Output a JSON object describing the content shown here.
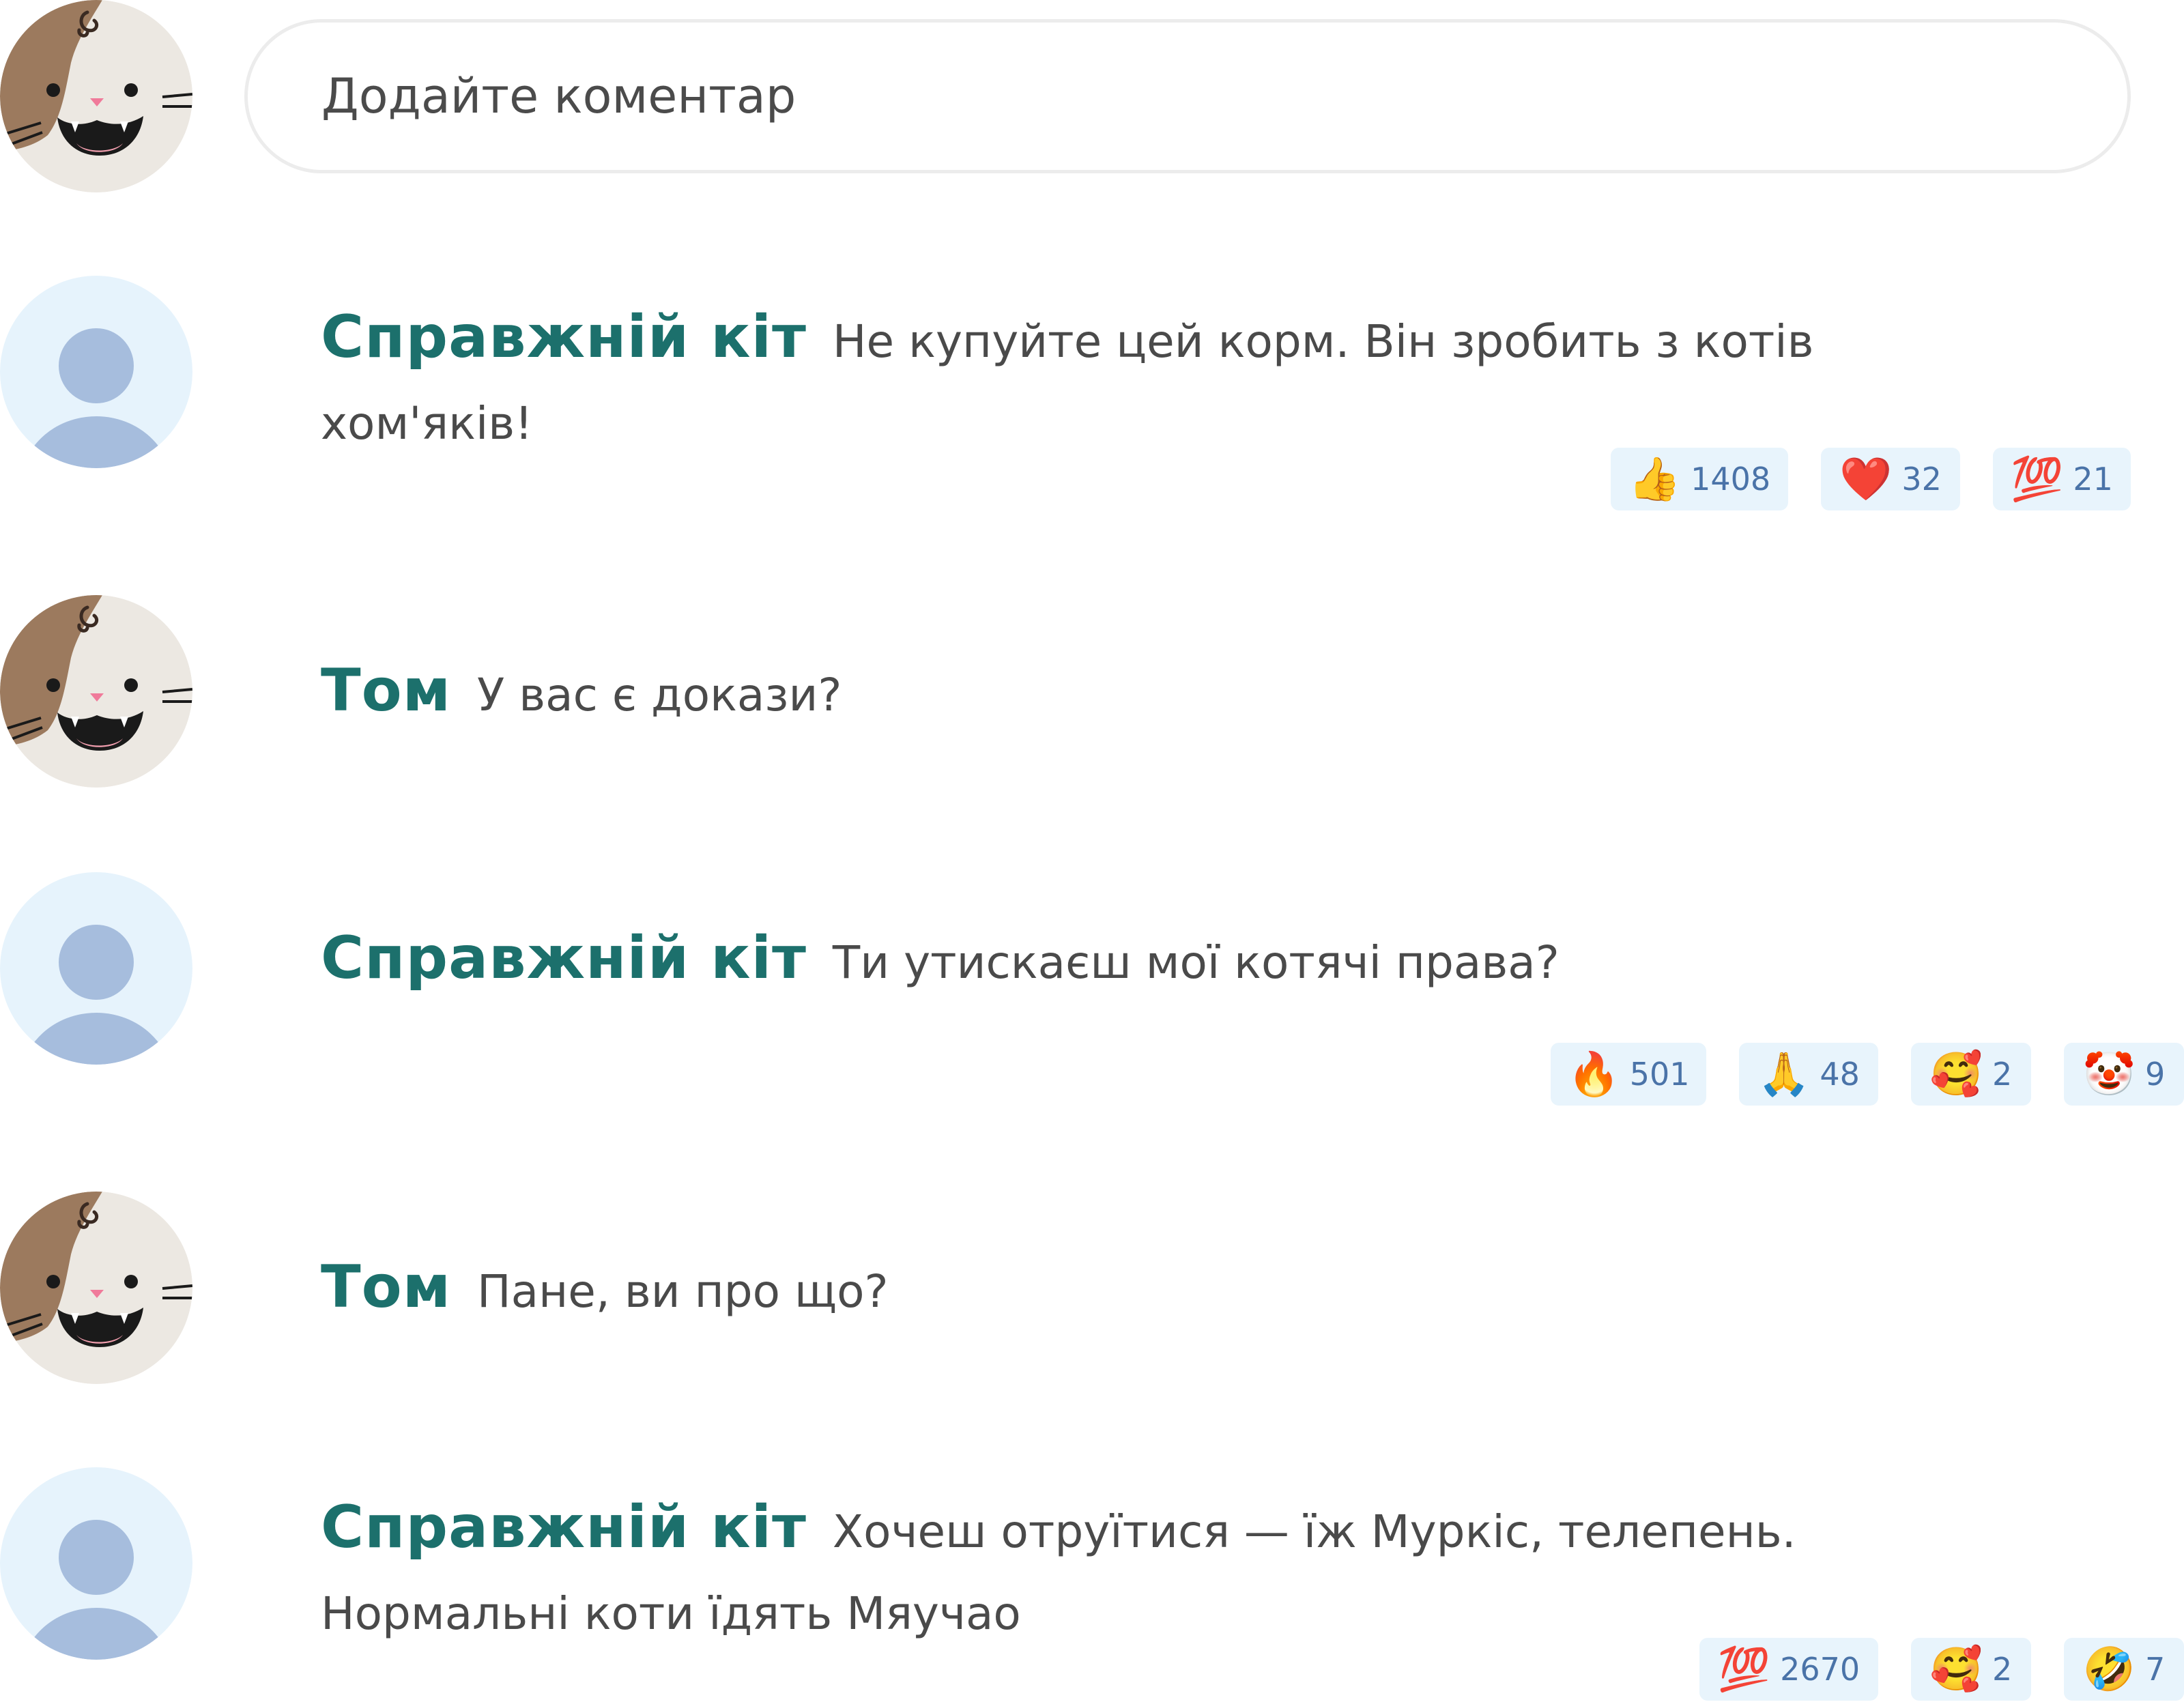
{
  "composer": {
    "placeholder": "Додайте коментар",
    "avatar_icon": "cat-avatar-icon"
  },
  "colors": {
    "author": "#1c706c",
    "reaction_bg": "#e8f4fc",
    "reaction_count": "#4a73a8",
    "input_border": "#ececec"
  },
  "comments": [
    {
      "author": "Справжній кіт",
      "avatar": "default-user-avatar",
      "text": "Не купуйте цей корм. Він зробить з котів хом'яків!",
      "reactions": [
        {
          "emoji": "👍",
          "icon": "thumbs-up-icon",
          "count": "1408"
        },
        {
          "emoji": "❤️",
          "icon": "heart-icon",
          "count": "32"
        },
        {
          "emoji": "💯",
          "icon": "hundred-points-icon",
          "count": "21"
        }
      ]
    },
    {
      "author": "Том",
      "avatar": "cat-avatar",
      "text": "У вас є докази?",
      "reactions": []
    },
    {
      "author": "Справжній кіт",
      "avatar": "default-user-avatar",
      "text": "Ти утискаєш мої котячі права?",
      "reactions": [
        {
          "emoji": "🔥",
          "icon": "fire-icon",
          "count": "501"
        },
        {
          "emoji": "🙏",
          "icon": "folded-hands-icon",
          "count": "48"
        },
        {
          "emoji": "🥰",
          "icon": "smiling-face-with-hearts-icon",
          "count": "2"
        },
        {
          "emoji": "🤡",
          "icon": "clown-face-icon",
          "count": "9"
        }
      ]
    },
    {
      "author": "Том",
      "avatar": "cat-avatar",
      "text": "Пане, ви про що?",
      "reactions": []
    },
    {
      "author": "Справжній кіт",
      "avatar": "default-user-avatar",
      "text": "Хочеш отруїтися — їж Муркіс, телепень. Нормальні коти їдять Мяучао",
      "reactions": [
        {
          "emoji": "💯",
          "icon": "hundred-points-icon",
          "count": "2670"
        },
        {
          "emoji": "🥰",
          "icon": "smiling-face-with-hearts-icon",
          "count": "2"
        },
        {
          "emoji": "🤣",
          "icon": "rolling-laughing-face-icon",
          "count": "7"
        }
      ]
    }
  ]
}
